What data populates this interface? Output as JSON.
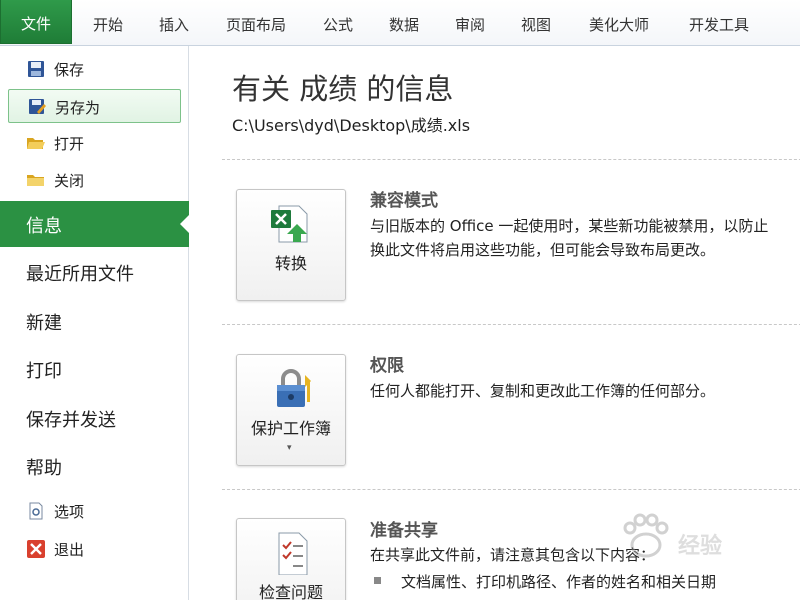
{
  "ribbon": {
    "tabs": [
      {
        "label": "文件",
        "active": true
      },
      {
        "label": "开始"
      },
      {
        "label": "插入"
      },
      {
        "label": "页面布局"
      },
      {
        "label": "公式"
      },
      {
        "label": "数据"
      },
      {
        "label": "审阅"
      },
      {
        "label": "视图"
      },
      {
        "label": "美化大师"
      },
      {
        "label": "开发工具"
      }
    ]
  },
  "sidebar": {
    "commands": [
      {
        "label": "保存",
        "icon": "save-icon"
      },
      {
        "label": "另存为",
        "icon": "save-as-icon",
        "selected": true
      },
      {
        "label": "打开",
        "icon": "open-folder-icon"
      },
      {
        "label": "关闭",
        "icon": "close-folder-icon"
      }
    ],
    "nav": [
      {
        "label": "信息",
        "active": true
      },
      {
        "label": "最近所用文件"
      },
      {
        "label": "新建"
      },
      {
        "label": "打印"
      },
      {
        "label": "保存并发送"
      },
      {
        "label": "帮助"
      }
    ],
    "bottom": [
      {
        "label": "选项",
        "icon": "options-icon"
      },
      {
        "label": "退出",
        "icon": "exit-icon"
      }
    ]
  },
  "info": {
    "title": "有关 成绩 的信息",
    "path": "C:\\Users\\dyd\\Desktop\\成绩.xls",
    "sections": [
      {
        "button_label": "转换",
        "heading": "兼容模式",
        "desc_line1": "与旧版本的 Office 一起使用时，某些新功能被禁用，以防止",
        "desc_line2": "换此文件将启用这些功能，但可能会导致布局更改。"
      },
      {
        "button_label": "保护工作簿",
        "dropdown": "▾",
        "heading": "权限",
        "desc_line1": "任何人都能打开、复制和更改此工作簿的任何部分。"
      },
      {
        "button_label": "检查问题",
        "heading": "准备共享",
        "desc_line1": "在共享此文件前，请注意其包含以下内容：",
        "bullet": "文档属性、打印机路径、作者的姓名和相关日期"
      }
    ]
  },
  "watermark": {
    "text": "经验"
  },
  "colors": {
    "accent": "#2b9143",
    "tab_bar": "#f4f6f9"
  }
}
